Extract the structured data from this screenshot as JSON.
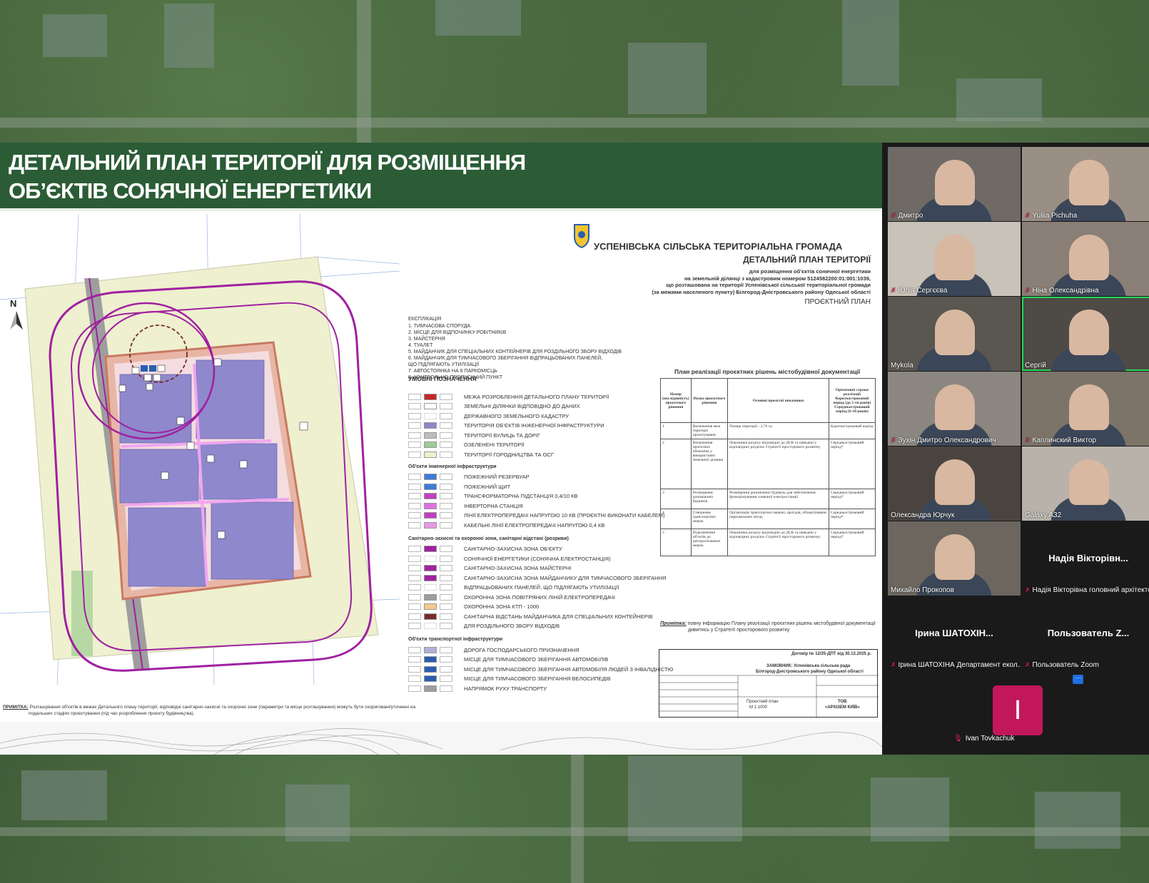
{
  "slide": {
    "title_line1": "ДЕТАЛЬНИЙ ПЛАН ТЕРИТОРІЇ ДЛЯ РОЗМІЩЕННЯ",
    "title_line2": "ОБ’ЄКТІВ СОНЯЧНОЇ ЕНЕРГЕТИКИ",
    "north": "N",
    "community": "УСПЕНІВСЬКА СІЛЬСЬКА ТЕРИТОРІАЛЬНА ГРОМАДА",
    "plan_title": "ДЕТАЛЬНИЙ ПЛАН ТЕРИТОРІЇ",
    "plan_sub1": "для розміщення об'єктів сонячної енергетики",
    "plan_sub2": "на земельній ділянці з кадастровим номером 5124582200:01:001:1039,",
    "plan_sub3": "що розташована на території Успенівської сільської територіальної громади",
    "plan_sub4": "(за межами населеного пункту) Білгород-Дністровського району Одеської області",
    "plan_kind": "ПРОЄКТНИЙ ПЛАН",
    "explication_title": "ЕКСПЛІКАЦІЯ",
    "explication": [
      "1. ТИМЧАСОВА СПОРУДА",
      "2. МІСЦЕ ДЛЯ ВІДПОЧИНКУ РОБІТНИКІВ",
      "3. МАЙСТЕРНЯ",
      "4. ТУАЛЕТ",
      "5. МАЙДАНЧИК ДЛЯ СПЕЦІАЛЬНИХ КОНТЕЙНЕРІВ ДЛЯ РОЗДІЛЬНОГО ЗБОРУ ВІДХОДІВ",
      "6. МАЙДАНЧИК ДЛЯ ТИМЧАСОВОГО ЗБЕРІГАННЯ ВІДПРАЦЬОВАНИХ ПАНЕЛЕЙ,",
      "ЩО ПІДЛЯГАЮТЬ УТИЛІЗАЦІЇ",
      "7. АВТОСТОЯНКА НА 6 ПАРКОМІСЦЬ",
      "8. КОНТРОЛЬНО-ПРОПУСКНИЙ ПУНКТ"
    ],
    "legend_title": "УМОВНІ ПОЗНАЧЕННЯ",
    "legend_main": [
      {
        "label": "МЕЖА РОЗРОБЛЕННЯ ДЕТАЛЬНОГО ПЛАНУ ТЕРИТОРІЇ",
        "color": "#c62828"
      },
      {
        "label": "ЗЕМЕЛЬНІ ДІЛЯНКИ ВІДПОВІДНО ДО ДАНИХ",
        "color": "#ffffff"
      },
      {
        "label": "ДЕРЖАВНОГО ЗЕМЕЛЬНОГО КАДАСТРУ",
        "color": ""
      },
      {
        "label": "ТЕРИТОРІЯ ОБ'ЄКТІВ ІНЖЕНЕРНОЇ ІНФРАСТРУКТУРИ",
        "color": "#8e86c8"
      },
      {
        "label": "ТЕРИТОРІЇ ВУЛИЦЬ ТА ДОРІГ",
        "color": "#bdbdbd"
      },
      {
        "label": "ОЗЕЛЕНЕНІ ТЕРИТОРІЇ",
        "color": "#9ecb9a"
      },
      {
        "label": "ТЕРИТОРІЇ ГОРОДНИЦТВА ТА ОСГ",
        "color": "#eef0cf"
      }
    ],
    "infra_title": "Об'єкти інженерної інфраструктури",
    "legend_infra": [
      {
        "label": "ПОЖЕЖНИЙ РЕЗЕРВУАР",
        "color": "#3d7bd9"
      },
      {
        "label": "ПОЖЕЖНИЙ ЩИТ",
        "color": "#3d7bd9"
      },
      {
        "label": "ТРАНСФОРМАТОРНА ПІДСТАНЦІЯ 0,4/10 КВ",
        "color": "#c040c0"
      },
      {
        "label": "ІНВЕРТОРНА СТАНЦІЯ",
        "color": "#e070e0"
      },
      {
        "label": "ЛІНІЇ ЕЛЕКТРОПЕРЕДАЧІ НАПРУГОЮ 10 КВ (ПРОЄКТНІ ВИКОНАТИ КАБЕЛЕМ)",
        "color": "#c040c0"
      },
      {
        "label": "КАБЕЛЬНІ ЛІНІЇ ЕЛЕКТРОПЕРЕДАЧІ НАПРУГОЮ 0,4 КВ",
        "color": "#e79ae7"
      }
    ],
    "zones_title": "Санітарно-захисні та охоронні зони, санітарні відстані (розриви)",
    "legend_zones": [
      {
        "label": "САНІТАРНО-ЗАХИСНА ЗОНА ОБ'ЄКТУ",
        "color": "#a020a0"
      },
      {
        "label": "СОНЯЧНОЇ ЕНЕРГЕТИКИ (СОНЯЧНА ЕЛЕКТРОСТАНЦІЯ)",
        "color": ""
      },
      {
        "label": "САНІТАРНО-ЗАХИСНА ЗОНА МАЙСТЕРНІ",
        "color": "#a020a0"
      },
      {
        "label": "САНІТАРНО-ЗАХИСНА ЗОНА МАЙДАНЧИКУ ДЛЯ ТИМЧАСОВОГО ЗБЕРІГАННЯ",
        "color": "#a020a0"
      },
      {
        "label": "ВІДПРАЦЬОВАНИХ ПАНЕЛЕЙ, ЩО ПІДЛЯГАЮТЬ УТИЛІЗАЦІЇ",
        "color": ""
      },
      {
        "label": "ОХОРОННА ЗОНА ПОВІТРЯНИХ ЛІНІЙ ЕЛЕКТРОПЕРЕДАЧІ",
        "color": "#9e9e9e"
      },
      {
        "label": "ОХОРОННА ЗОНА КТП - 1000",
        "color": "#f6c98c"
      },
      {
        "label": "САНІТАРНА ВІДСТАНЬ МАЙДАНЧИКА ДЛЯ СПЕЦІАЛЬНИХ КОНТЕЙНЕРІВ",
        "color": "#7a2a2a"
      },
      {
        "label": "ДЛЯ РОЗДІЛЬНОГО ЗБОРУ ВІДХОДІВ",
        "color": ""
      }
    ],
    "transport_title": "Об'єкти транспортної інфраструктури",
    "legend_transport": [
      {
        "label": "ДОРОГА ГОСПОДАРСЬКОГО ПРИЗНАЧЕННЯ",
        "color": "#b0b0d8"
      },
      {
        "label": "МІСЦЕ ДЛЯ ТИМЧАСОВОГО ЗБЕРІГАННЯ АВТОМОБІЛІВ",
        "color": "#2a5db0"
      },
      {
        "label": "МІСЦЕ ДЛЯ ТИМЧАСОВОГО ЗБЕРІГАННЯ АВТОМОБІЛЯ ЛЮДЕЙ З ІНВАЛІДНІСТЮ",
        "color": "#2a5db0"
      },
      {
        "label": "МІСЦЕ ДЛЯ ТИМЧАСОВОГО ЗБЕРІГАННЯ ВЕЛОСИПЕДІВ",
        "color": "#2a5db0"
      },
      {
        "label": "НАПРЯМОК РУХУ ТРАНСПОРТУ",
        "color": "#9e9e9e"
      }
    ],
    "implementation_title": "План реалізації проєктних рішень містобудівної документації",
    "impl_headers": [
      "Номер (послідовність) проєктного рішення",
      "Назва проєктного рішення",
      "Основні проєктні показники",
      "Орієнтовні строки реалізації Короткостроковий період (до 5-ти років) Середньостроковий період (6-10 років)"
    ],
    "impl_rows": [
      [
        "1",
        "Визначення меж території проєктування",
        "Площа території - 2,76 га.",
        "Короткостроковий період"
      ],
      [
        "2",
        "Визначення проєктних обмежень у використанні земельної ділянки",
        "Показники розділу відповідно до ДСК та наведені у відповідних розділах Стратегії просторового розвитку",
        "Середньостроковий період*"
      ],
      [
        "3",
        "Розміщення допоміжних будинків",
        "Розміщення допоміжних будівель для забезпечення функціонування сонячної електростанції",
        "Середньостроковий період*"
      ],
      [
        "4",
        "Створення транспортних мереж",
        "Організація транспортної мережі, проїздів, облаштування паркувальних місць",
        "Середньостроковий період*"
      ],
      [
        "5",
        "Підключення об'єктів до централізованих мереж",
        "Показники розділу відповідно до ДСК та наведені у відповідних розділах Стратегії просторового розвитку",
        "Середньостроковий період*"
      ]
    ],
    "note_label": "Примітка:",
    "note_text1": "повну інформацію Плану реалізації проєктних рішень містобудівної документації",
    "note_text2": "дивитись у Стратегії просторового розвитку",
    "contract": "Договір № 12/25-ДПТ від 30.12.2025 р.",
    "customer1": "ЗАМОВНИК: Успенівська сільська рада",
    "customer2": "Білгород-Дністровського району Одеської області",
    "stamp_plan": "Проєктний план",
    "stamp_scale": "М 1:1000",
    "stamp_org1": "ТОВ",
    "stamp_org2": "«АРХІЗЕМ КИЇВ»",
    "bottom_note_label": "ПРИМІТКА:",
    "bottom_note1": "Розташування об'єктів в межах Детального плану території, відповідні санітарно-захисні та охоронні зони (параметри та місце розташування) можуть бути скориговані/уточнені на",
    "bottom_note2": "подальших стадіях проєктування (під час розроблення проєкту будівництва)."
  },
  "participants": [
    {
      "name": "Дмитро",
      "muted": true,
      "video": true
    },
    {
      "name": "Yuliia Pichuha",
      "muted": true,
      "video": true
    },
    {
      "name": "Юлія Сергєєва",
      "muted": true,
      "video": true
    },
    {
      "name": "Ніна Олександрівна",
      "muted": true,
      "video": true
    },
    {
      "name": "Mykola",
      "muted": false,
      "video": true
    },
    {
      "name": "Сергій",
      "muted": false,
      "video": true,
      "active": true
    },
    {
      "name": "Зухін Дмитро Олександрович",
      "muted": true,
      "video": true
    },
    {
      "name": "Каплинский Виктор",
      "muted": true,
      "video": true
    },
    {
      "name": "Олександра Юрчук",
      "muted": false,
      "video": true
    },
    {
      "name": "Galaxy A32",
      "muted": false,
      "video": true
    },
    {
      "name": "Михайло Прокопов",
      "muted": false,
      "video": true
    },
    {
      "name": "Надія Вікторівна головний архітекто...",
      "display": "Надія Вікторівн...",
      "muted": true,
      "video": false
    },
    {
      "name": "Ірина ШАТОХІНА Департамент екол...",
      "display": "Ірина  ШАТОХІН...",
      "muted": true,
      "video": false
    },
    {
      "name": "Пользователь Zoom",
      "display": "Пользователь  Z...",
      "muted": true,
      "video": false
    }
  ],
  "self": {
    "name": "Ivan Tovkachuk",
    "initial": "I",
    "avatar_color": "#c2185b"
  },
  "more_label": "···",
  "colors": {
    "header_green": "#2b5c36",
    "zoom_bg": "#1a1a1a",
    "active_speaker": "#23d959",
    "muted_red": "#e0245e"
  }
}
